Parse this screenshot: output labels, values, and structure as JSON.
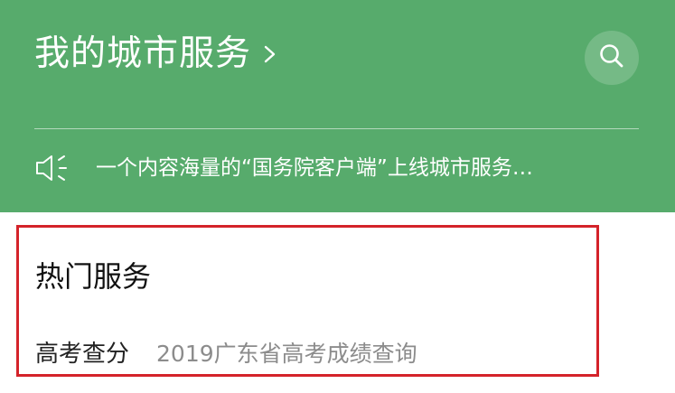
{
  "header": {
    "title": "我的城市服务",
    "notice": "一个内容海量的“国务院客户端”上线城市服务…",
    "icons": {
      "chevron": "chevron-right-icon",
      "search": "search-icon",
      "notice": "speaker-icon"
    },
    "colors": {
      "background": "#57ab6c",
      "text": "#ffffff"
    }
  },
  "hot_services": {
    "title": "热门服务",
    "items": [
      {
        "name": "高考查分",
        "description": "2019广东省高考成绩查询"
      }
    ],
    "highlight_color": "#d4232a"
  }
}
